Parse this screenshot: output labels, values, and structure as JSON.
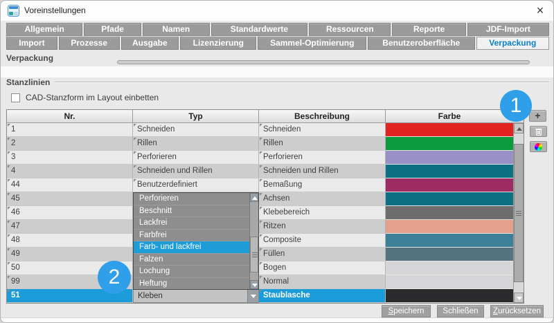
{
  "window": {
    "title": "Voreinstellungen",
    "close_glyph": "×"
  },
  "tabs": {
    "row1": [
      {
        "label": "Allgemein"
      },
      {
        "label": "Pfade"
      },
      {
        "label": "Namen"
      },
      {
        "label": "Standardwerte"
      },
      {
        "label": "Ressourcen"
      },
      {
        "label": "Reporte"
      },
      {
        "label": "JDF-Import"
      }
    ],
    "row2": [
      {
        "label": "Import"
      },
      {
        "label": "Prozesse"
      },
      {
        "label": "Ausgabe"
      },
      {
        "label": "Lizenzierung"
      },
      {
        "label": "Sammel-Optimierung"
      },
      {
        "label": "Benutzeroberfläche"
      },
      {
        "label": "Verpackung",
        "active": true
      }
    ]
  },
  "sections": {
    "verpackung": "Verpackung",
    "stanzlinien": "Stanzlinien",
    "checkbox_label": "CAD-Stanzform im Layout einbetten",
    "checkbox_checked": false
  },
  "table": {
    "columns": [
      "Nr.",
      "Typ",
      "Beschreibung",
      "Farbe"
    ],
    "rows": [
      {
        "nr": "1",
        "typ": "Schneiden",
        "beschreibung": "Schneiden",
        "farbe": "#e32222"
      },
      {
        "nr": "2",
        "typ": "Rillen",
        "beschreibung": "Rillen",
        "farbe": "#0b9b3d"
      },
      {
        "nr": "3",
        "typ": "Perforieren",
        "beschreibung": "Perforieren",
        "farbe": "#9a90c8"
      },
      {
        "nr": "4",
        "typ": "Schneiden und Rillen",
        "beschreibung": "Schneiden und Rillen",
        "farbe": "#0d7085"
      },
      {
        "nr": "44",
        "typ": "Benutzerdefiniert",
        "beschreibung": "Bemaßung",
        "farbe": "#9c2c62"
      },
      {
        "nr": "45",
        "typ": "",
        "beschreibung": "Achsen",
        "farbe": "#0d7085"
      },
      {
        "nr": "46",
        "typ": "",
        "beschreibung": "Klebebereich",
        "farbe": "#6d6d6d"
      },
      {
        "nr": "47",
        "typ": "",
        "beschreibung": "Ritzen",
        "farbe": "#e2a08d"
      },
      {
        "nr": "48",
        "typ": "",
        "beschreibung": "Composite",
        "farbe": "#3b7f99"
      },
      {
        "nr": "49",
        "typ": "",
        "beschreibung": "Füllen",
        "farbe": "#55737f"
      },
      {
        "nr": "50",
        "typ": "",
        "beschreibung": "Bogen",
        "farbe": "#d6d6d9"
      },
      {
        "nr": "99",
        "typ": "",
        "beschreibung": "Normal",
        "farbe": "#d5d5d8"
      },
      {
        "nr": "51",
        "typ": "Kleben",
        "beschreibung": "Staublasche",
        "farbe": "#2b2b2d",
        "selected": true
      }
    ]
  },
  "dropdown": {
    "items": [
      {
        "label": "Perforieren"
      },
      {
        "label": "Beschnitt"
      },
      {
        "label": "Lackfrei"
      },
      {
        "label": "Farbfrei"
      },
      {
        "label": "Farb- und lackfrei",
        "highlighted": true
      },
      {
        "label": "Falzen"
      },
      {
        "label": "Lochung"
      },
      {
        "label": "Heftung"
      }
    ]
  },
  "side_buttons": {
    "add_label": "+"
  },
  "footer": {
    "buttons": [
      {
        "mnemonic": "S",
        "rest": "peichern"
      },
      {
        "mnemonic": "",
        "rest": "Schließen"
      },
      {
        "mnemonic": "Z",
        "rest": "urücksetzen"
      }
    ]
  },
  "annotations": [
    {
      "number": "1"
    },
    {
      "number": "2"
    }
  ],
  "colors": {
    "selection": "#1b9bd7",
    "dropdown_highlight": "#1e9cd7",
    "annotation": "#2e9fe8",
    "tab_active_text": "#0a80c6"
  }
}
